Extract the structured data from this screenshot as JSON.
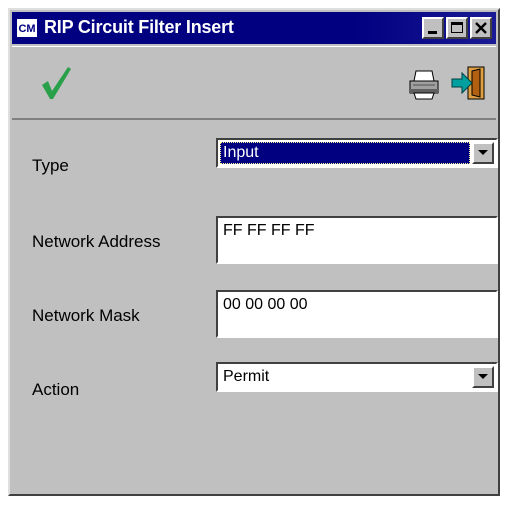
{
  "window": {
    "app_icon_text": "CM",
    "title": "RIP Circuit Filter Insert"
  },
  "toolbar": {
    "ok_icon": "checkmark-icon",
    "print_icon": "printer-icon",
    "exit_icon": "exit-door-icon"
  },
  "form": {
    "type": {
      "label": "Type",
      "value": "Input"
    },
    "network_address": {
      "label": "Network Address",
      "value": "FF FF FF FF"
    },
    "network_mask": {
      "label": "Network Mask",
      "value": "00 00 00 00"
    },
    "action": {
      "label": "Action",
      "value": "Permit"
    }
  },
  "colors": {
    "titlebar": "#000080",
    "window_face": "#c0c0c0",
    "checkmark": "#2aa04a",
    "exit_arrow": "#00a0a0"
  }
}
